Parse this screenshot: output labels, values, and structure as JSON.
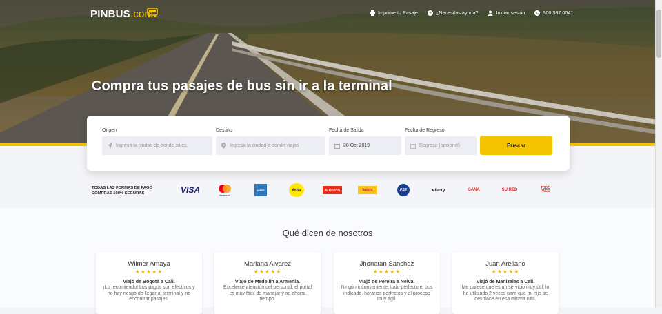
{
  "brand": {
    "name": "PINBUS",
    "suffix": ".com",
    "accent": "#f5c400"
  },
  "nav": [
    {
      "label": "Imprime tu Pasaje",
      "icon": "printer-icon"
    },
    {
      "label": "¿Necesitas ayuda?",
      "icon": "help-icon"
    },
    {
      "label": "Iniciar sesión",
      "icon": "user-icon"
    },
    {
      "label": "300 387 0041",
      "icon": "phone-icon"
    }
  ],
  "hero": {
    "headline": "Compra tus pasajes de bus sin ir a la terminal"
  },
  "search": {
    "origin_label": "Origen",
    "origin_placeholder": "Ingresa la ciudad de donde sales",
    "destination_label": "Destino",
    "destination_placeholder": "Ingresa la ciudad a donde viajas",
    "departure_label": "Fecha de Salida",
    "departure_value": "28 Oct 2019",
    "return_label": "Fecha de Regreso",
    "return_placeholder": "Regreso (opcional)",
    "button_label": "Buscar"
  },
  "payments": {
    "label_line1": "TODAS LAS FORMAS DE PAGO",
    "label_line2": "COMPRAS 100% SEGURAS",
    "methods": [
      "VISA",
      "mastercard",
      "AMEX",
      "éxito",
      "ALKOSTO",
      "baloto",
      "PSE",
      "efecty",
      "GANA",
      "SU RED",
      "TODO PAGO"
    ]
  },
  "testimonials": {
    "title": "Qué dicen de nosotros",
    "stars": "★★★★★",
    "items": [
      {
        "name": "Wilmer Amaya",
        "route": "Viajó de Bogotá a Cali.",
        "text": "¡Lo recomiendo! Los pagos son efectivos y no hay riesgo de llegar al terminal y no encontrar pasajes."
      },
      {
        "name": "Mariana Alvarez",
        "route": "Viajó de Medellín a Armenia.",
        "text": "Excelente atención del personal, el portal es muy fácil de manejar y se ahorra tiempo."
      },
      {
        "name": "Jhonatan Sanchez",
        "route": "Viajó de Pereira a Neiva.",
        "text": "Ningún inconveniente, todo perfecto el bus indicado, horarios perfectos y el proceso muy ágil."
      },
      {
        "name": "Juan Arellano",
        "route": "Viajó de Manizales a Cali.",
        "text": "Me parece que es un servicio muy útil; lo he utilizado 2 veces para que mi hijo se desplace en esa misma ruta."
      }
    ]
  }
}
